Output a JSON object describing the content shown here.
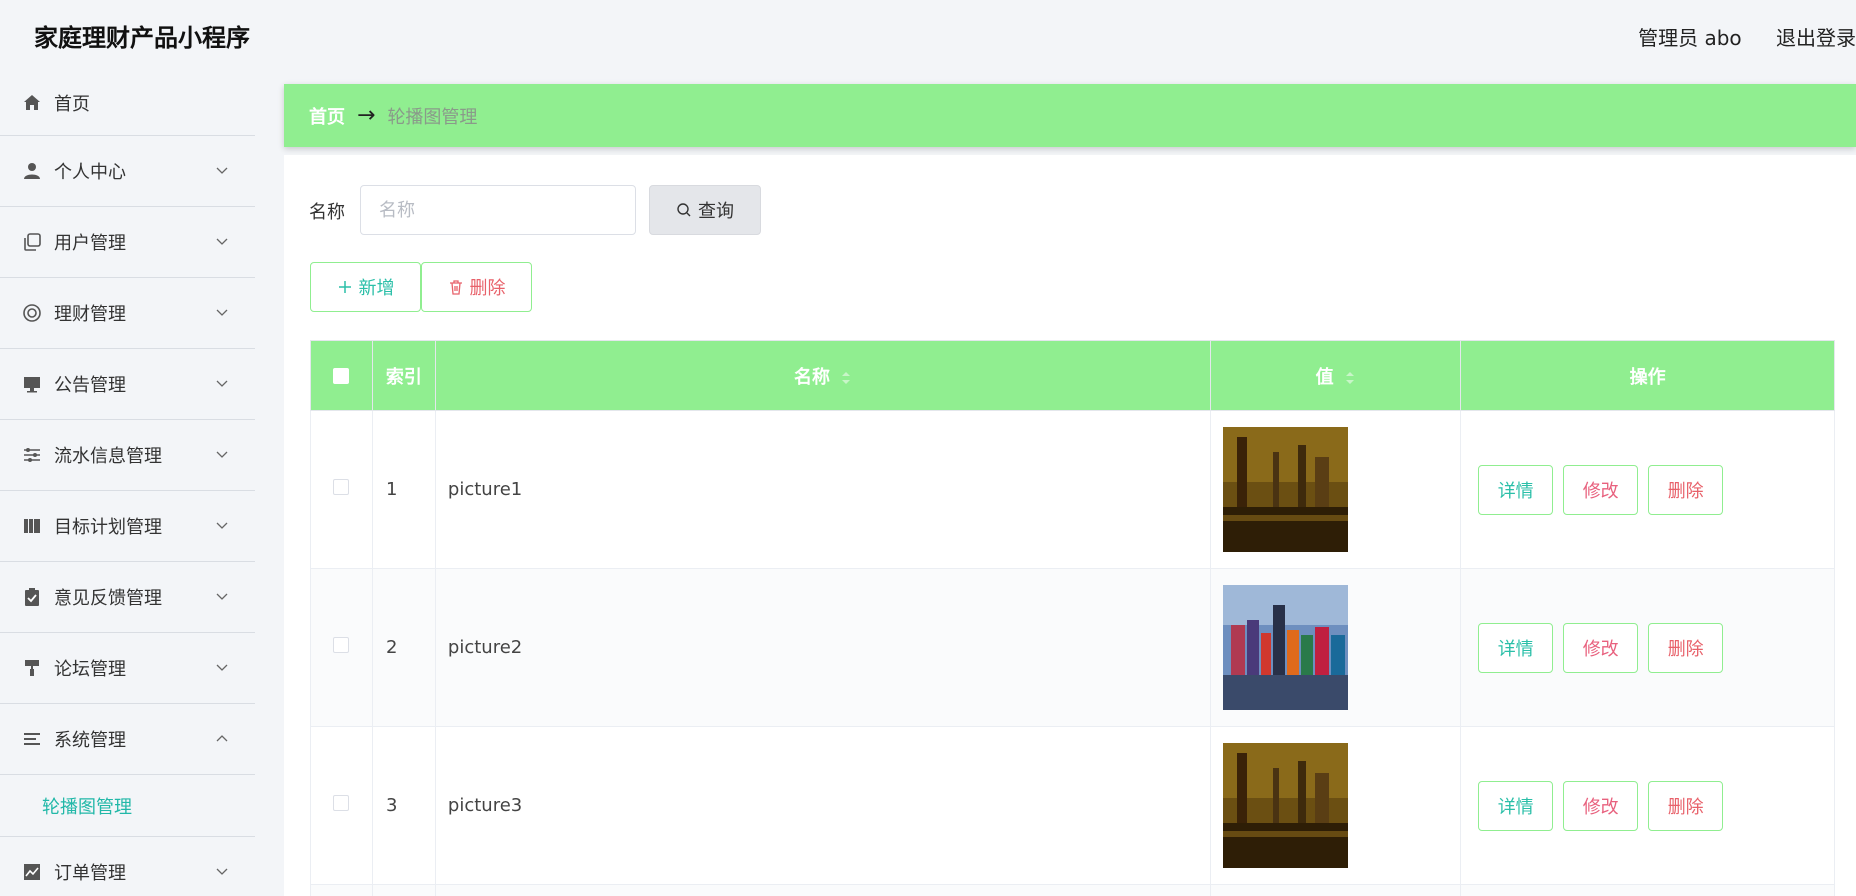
{
  "app": {
    "title": "家庭理财产品小程序"
  },
  "header": {
    "user_label": "管理员 abo",
    "logout_label": "退出登录"
  },
  "sidebar": {
    "items": [
      {
        "label": "首页",
        "icon": "home-icon"
      },
      {
        "label": "个人中心",
        "icon": "person-icon"
      },
      {
        "label": "用户管理",
        "icon": "copy-icon"
      },
      {
        "label": "理财管理",
        "icon": "lifebuoy-icon"
      },
      {
        "label": "公告管理",
        "icon": "monitor-icon"
      },
      {
        "label": "流水信息管理",
        "icon": "sliders-icon"
      },
      {
        "label": "目标计划管理",
        "icon": "books-icon"
      },
      {
        "label": "意见反馈管理",
        "icon": "clipboard-check-icon"
      },
      {
        "label": "论坛管理",
        "icon": "paint-roller-icon"
      },
      {
        "label": "系统管理",
        "icon": "list-icon",
        "expanded": true
      },
      {
        "label": "订单管理",
        "icon": "chart-line-icon"
      }
    ],
    "sub_items": {
      "system": [
        "轮播图管理"
      ]
    },
    "active_color": "#22b8a8"
  },
  "breadcrumb": {
    "home": "首页",
    "separator": "→",
    "current": "轮播图管理"
  },
  "search": {
    "label": "名称",
    "placeholder": "名称",
    "button_label": "查询"
  },
  "actions": {
    "add_label": "新增",
    "delete_label": "删除"
  },
  "table": {
    "headers": {
      "index": "索引",
      "name": "名称",
      "value": "值",
      "ops": "操作"
    },
    "rows": [
      {
        "index": "1",
        "name": "picture1",
        "image": "city-sepia"
      },
      {
        "index": "2",
        "name": "picture2",
        "image": "city-colorful"
      },
      {
        "index": "3",
        "name": "picture3",
        "image": "city-sepia"
      }
    ],
    "op_labels": {
      "detail": "详情",
      "edit": "修改",
      "delete": "删除"
    }
  },
  "colors": {
    "accent": "#90ee90",
    "teal": "#2bbfa8",
    "danger": "#e8616a",
    "edit": "#e8617e"
  }
}
